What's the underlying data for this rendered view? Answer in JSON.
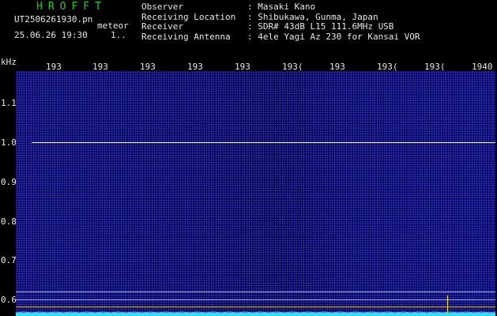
{
  "header": {
    "app_title": "HROFFT",
    "filename": "UT2506261930.pn",
    "filename_suffix": "meteor",
    "timestamp": "25.06.26 19:30",
    "timestamp_extra": "1..",
    "observer_label": "Observer",
    "observer_value": ": Masaki Kano",
    "location_label": "Receiving Location",
    "location_value": ": Shibukawa, Gunma, Japan",
    "receiver_label": "Receiver",
    "receiver_value": ": SDR# 43dB L15 111.6MHz USB",
    "antenna_label": "Receiving Antenna",
    "antenna_value": ": 4ele Yagi Az 230 for Kansai VOR"
  },
  "axes": {
    "y_unit": "kHz",
    "x_ticks": [
      "193",
      "193",
      "193",
      "193",
      "193",
      "193(",
      "193",
      "193(",
      "193(",
      "1940"
    ],
    "y_ticks": [
      "1.1",
      "1.0",
      "0.9",
      "0.8",
      "0.7",
      "0.6"
    ]
  },
  "colors": {
    "background": "#0a0a5c",
    "title": "#22cc22",
    "text": "#e8e8e8",
    "marker_lines": "#c9b877",
    "event_mark": "#ffee33",
    "noise_floor": "#33ddee"
  }
}
